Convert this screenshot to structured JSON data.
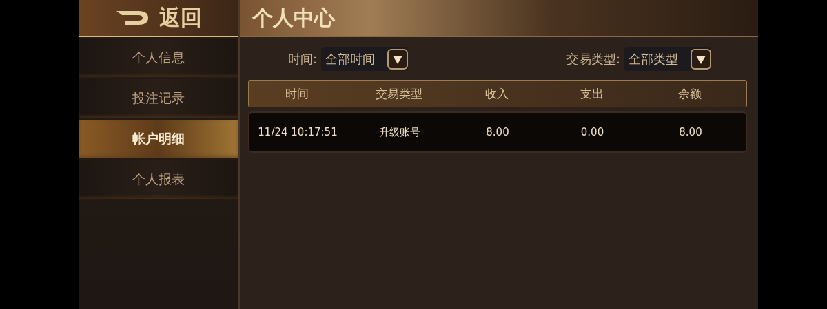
{
  "back_button": {
    "label": "返回"
  },
  "title": "个人中心",
  "sidebar": {
    "items": [
      {
        "label": "个人信息",
        "selected": false
      },
      {
        "label": "投注记录",
        "selected": false
      },
      {
        "label": "帐户明细",
        "selected": true
      },
      {
        "label": "个人报表",
        "selected": false
      }
    ]
  },
  "filters": [
    {
      "label": "时间:",
      "value": "全部时间"
    },
    {
      "label": "交易类型:",
      "value": "全部类型"
    }
  ],
  "table": {
    "columns": [
      "时间",
      "交易类型",
      "收入",
      "支出",
      "余额"
    ],
    "rows": [
      [
        "11/24 10:17:51",
        "升级账号",
        "8.00",
        "0.00",
        "8.00"
      ]
    ]
  }
}
